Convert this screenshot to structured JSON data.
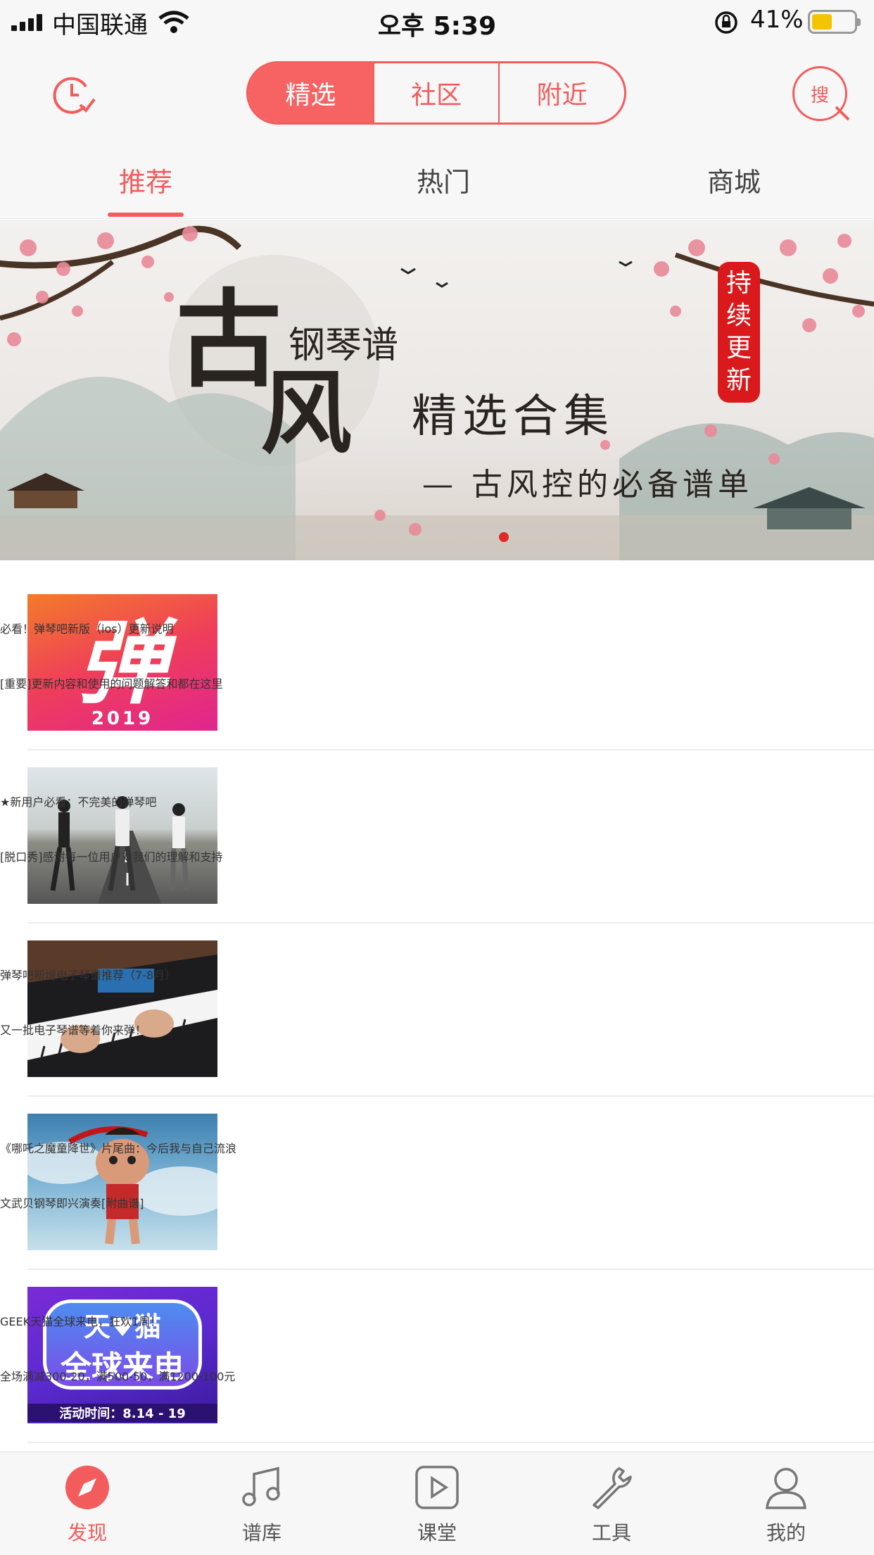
{
  "status_bar": {
    "carrier": "中国联通",
    "time": "오후 5:39",
    "battery": "41%"
  },
  "header": {
    "segments": [
      "精选",
      "社区",
      "附近"
    ],
    "search_label": "搜"
  },
  "tabs": [
    "推荐",
    "热门",
    "商城"
  ],
  "banner": {
    "big_char_1": "古",
    "big_char_2": "风",
    "subtitle_1": "钢琴谱",
    "subtitle_2": "精选合集",
    "tagline": "— 古风控的必备谱单",
    "stamp": "持续更新"
  },
  "thumb_text": {
    "dan": "弹",
    "year": "2019",
    "tmall_1": "天♥猫",
    "tmall_2": "全球来电",
    "tmall_3": "活动时间：8.14 - 19"
  },
  "articles": [
    {
      "title": "必看！弹琴吧新版（ios）更新说明",
      "subtitle": "[重要]更新内容和使用的问题解答和都在这里"
    },
    {
      "title": "★新用户必看：不完美的弹琴吧",
      "subtitle": "[脱口秀]感谢每一位用户对我们的理解和支持"
    },
    {
      "title": "弹琴吧新增电子琴谱推荐（7-8月）",
      "subtitle": "又一批电子琴谱等着你来弹！"
    },
    {
      "title": "《哪吒之魔童降世》片尾曲：今后我与自己流浪",
      "subtitle": "文武贝钢琴即兴演奏[附曲谱]"
    },
    {
      "title": "GEEK天猫全球来电，狂欢1周！",
      "subtitle": "全场满减300-20，满500-50，满1200-100元"
    }
  ],
  "bottom_nav": [
    {
      "label": "发现",
      "icon": "compass-icon"
    },
    {
      "label": "谱库",
      "icon": "music-note-icon"
    },
    {
      "label": "课堂",
      "icon": "play-icon"
    },
    {
      "label": "工具",
      "icon": "wrench-icon"
    },
    {
      "label": "我的",
      "icon": "user-icon"
    }
  ],
  "colors": {
    "accent": "#f25c5c",
    "background": "#f7f7f7"
  }
}
